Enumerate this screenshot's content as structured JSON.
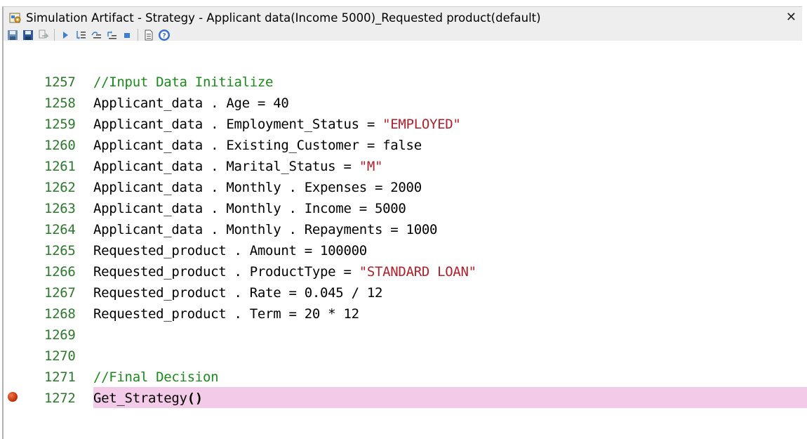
{
  "window": {
    "title": "Simulation Artifact - Strategy - Applicant data(Income 5000)_Requested product(default)",
    "close_glyph": "✕"
  },
  "toolbar": {
    "icons": [
      "save-icon",
      "save-as-icon",
      "step-icon",
      "run-icon",
      "step-in-icon",
      "step-over-icon",
      "step-out-icon",
      "stop-icon",
      "document-icon",
      "help-icon"
    ]
  },
  "editor": {
    "lines": [
      {
        "num": "1257",
        "text": "//Input Data Initialize",
        "kind": "comment"
      },
      {
        "num": "1258",
        "pre": "Applicant_data . Age = 40",
        "str": ""
      },
      {
        "num": "1259",
        "pre": "Applicant_data . Employment_Status = ",
        "str": "\"EMPLOYED\""
      },
      {
        "num": "1260",
        "pre": "Applicant_data . Existing_Customer = false",
        "str": ""
      },
      {
        "num": "1261",
        "pre": "Applicant_data . Marital_Status = ",
        "str": "\"M\""
      },
      {
        "num": "1262",
        "pre": "Applicant_data . Monthly . Expenses = 2000",
        "str": ""
      },
      {
        "num": "1263",
        "pre": "Applicant_data . Monthly . Income = 5000",
        "str": ""
      },
      {
        "num": "1264",
        "pre": "Applicant_data . Monthly . Repayments = 1000",
        "str": ""
      },
      {
        "num": "1265",
        "pre": "Requested_product . Amount = 100000",
        "str": ""
      },
      {
        "num": "1266",
        "pre": "Requested_product . ProductType = ",
        "str": "\"STANDARD LOAN\""
      },
      {
        "num": "1267",
        "pre": "Requested_product . Rate = 0.045 / 12",
        "str": ""
      },
      {
        "num": "1268",
        "pre": "Requested_product . Term = 20 * 12",
        "str": ""
      },
      {
        "num": "1269",
        "pre": "",
        "str": ""
      },
      {
        "num": "1270",
        "pre": "",
        "str": ""
      },
      {
        "num": "1271",
        "text": "//Final Decision",
        "kind": "comment"
      },
      {
        "num": "1272",
        "pre": "Get_Strategy",
        "bold": "()",
        "str": ""
      }
    ],
    "breakpoint_line": "1272",
    "highlight_color": "#f3cbe9"
  }
}
